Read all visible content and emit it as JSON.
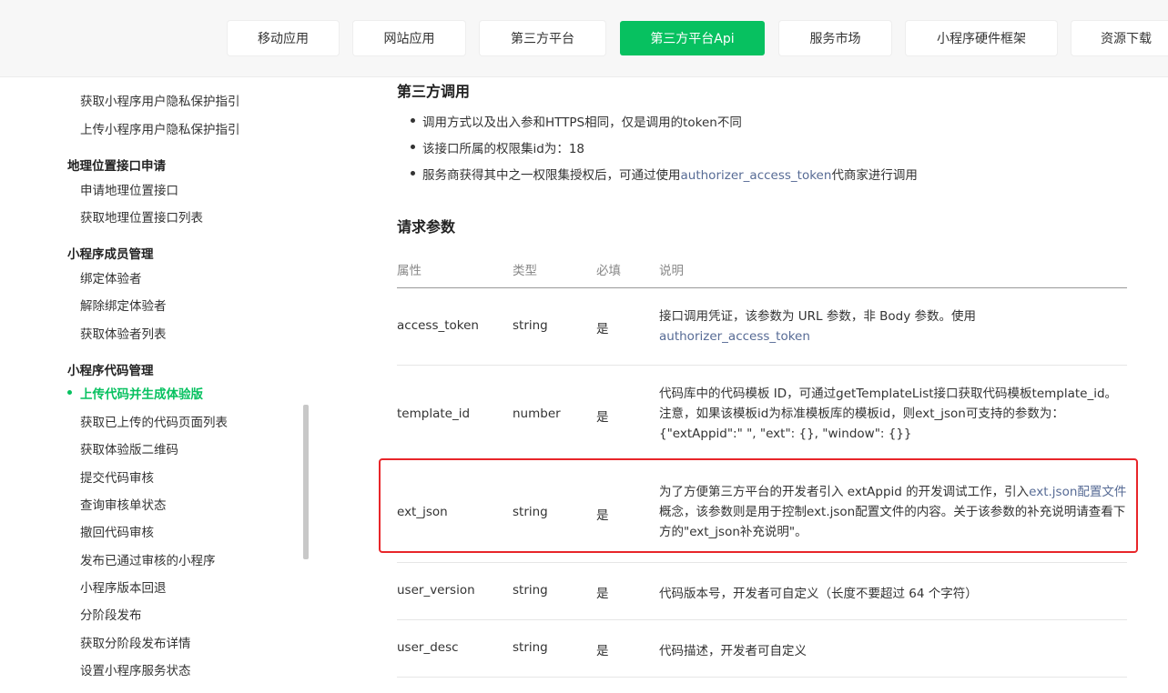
{
  "nav": {
    "tabs": [
      {
        "label": "移动应用"
      },
      {
        "label": "网站应用"
      },
      {
        "label": "第三方平台"
      },
      {
        "label": "第三方平台Api"
      },
      {
        "label": "服务市场"
      },
      {
        "label": "小程序硬件框架"
      },
      {
        "label": "资源下载"
      }
    ],
    "active_color": "#07c160"
  },
  "sidebar": {
    "items": [
      "获取小程序用户隐私保护指引",
      "上传小程序用户隐私保护指引",
      "申请地理位置接口",
      "获取地理位置接口列表",
      "绑定体验者",
      "解除绑定体验者",
      "获取体验者列表",
      "上传代码并生成体验版",
      "获取已上传的代码页面列表",
      "获取体验版二维码",
      "提交代码审核",
      "查询审核单状态",
      "撤回代码审核",
      "发布已通过审核的小程序",
      "小程序版本回退",
      "分阶段发布",
      "获取分阶段发布详情",
      "设置小程序服务状态"
    ],
    "groups": [
      "地理位置接口申请",
      "小程序成员管理",
      "小程序代码管理"
    ]
  },
  "content": {
    "third_party_title": "第三方调用",
    "bullets": {
      "b1": "调用方式以及出入参和HTTPS相同，仅是调用的token不同",
      "b2": "该接口所属的权限集id为：18",
      "b3_pre": "服务商获得其中之一权限集授权后，可通过使用",
      "b3_link": "authorizer_access_token",
      "b3_post": "代商家进行调用"
    },
    "params_title": "请求参数",
    "headers": [
      "属性",
      "类型",
      "必填",
      "说明"
    ],
    "rows": [
      {
        "name": "access_token",
        "type": "string",
        "required": "是",
        "desc_pre": "接口调用凭证，该参数为 URL 参数，非 Body 参数。使用",
        "desc_link": "authorizer_access_token"
      },
      {
        "name": "template_id",
        "type": "number",
        "required": "是",
        "desc_l1": "代码库中的代码模板 ID，可通过getTemplateList接口获取代码模板template_id。",
        "desc_l2": "注意，如果该模板id为标准模板库的模板id，则ext_json可支持的参数为：",
        "desc_l3": "{\"extAppid\":\" \", \"ext\": {}, \"window\": {}}"
      },
      {
        "name": "ext_json",
        "type": "string",
        "required": "是",
        "desc_pre": "为了方便第三方平台的开发者引入 extAppid 的开发调试工作，引入",
        "desc_link": "ext.json配置文件",
        "desc_post": "概念，该参数则是用于控制ext.json配置文件的内容。关于该参数的补充说明请查看下方的\"ext_json补充说明\"。"
      },
      {
        "name": "user_version",
        "type": "string",
        "required": "是",
        "desc": "代码版本号，开发者可自定义（长度不要超过 64 个字符）"
      },
      {
        "name": "user_desc",
        "type": "string",
        "required": "是",
        "desc": "代码描述，开发者可自定义"
      }
    ],
    "highlight_color": "#e8262a"
  }
}
